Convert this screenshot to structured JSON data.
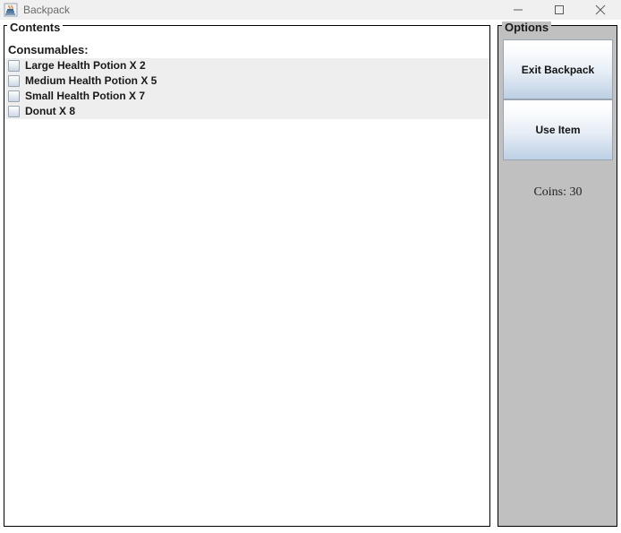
{
  "window": {
    "title": "Backpack",
    "icon": "java-coffee-cup-icon",
    "minimize_label": "—",
    "maximize_label": "□",
    "close_label": "✕"
  },
  "contents": {
    "legend": "Contents",
    "section_header": "Consumables:",
    "items": [
      {
        "label": "Large Health Potion X 2",
        "checked": false
      },
      {
        "label": "Medium Health Potion X 5",
        "checked": false
      },
      {
        "label": "Small Health Potion X 7",
        "checked": false
      },
      {
        "label": "Donut X 8",
        "checked": false
      }
    ]
  },
  "options": {
    "legend": "Options",
    "exit_label": "Exit Backpack",
    "use_item_label": "Use Item",
    "coins_label": "Coins: 30"
  },
  "colors": {
    "titlebar_bg": "#f0f0f0",
    "panel_border": "#000000",
    "contents_bg": "#ffffff",
    "options_bg": "#c0c0c0",
    "list_bg": "#eeeeee",
    "button_top": "#ffffff",
    "button_bottom": "#bdd0e4",
    "text": "#1a1a1a",
    "title_text": "#6b6b6b"
  }
}
